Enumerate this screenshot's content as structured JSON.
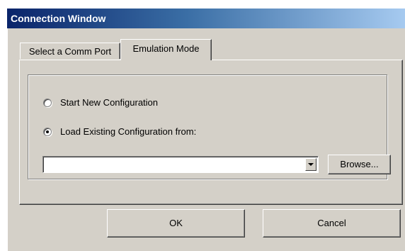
{
  "window": {
    "title": "Connection Window"
  },
  "tabs": [
    {
      "label": "Select a Comm Port",
      "active": false
    },
    {
      "label": "Emulation Mode",
      "active": true
    }
  ],
  "options": {
    "start_new": {
      "label": "Start New Configuration",
      "checked": false
    },
    "load_existing": {
      "label": "Load Existing Configuration from:",
      "checked": true
    }
  },
  "config_path": {
    "value": ""
  },
  "buttons": {
    "browse": "Browse...",
    "ok": "OK",
    "cancel": "Cancel"
  },
  "colors": {
    "title_start": "#0a246a",
    "title_end": "#a6caf0",
    "face": "#d4d0c8"
  }
}
